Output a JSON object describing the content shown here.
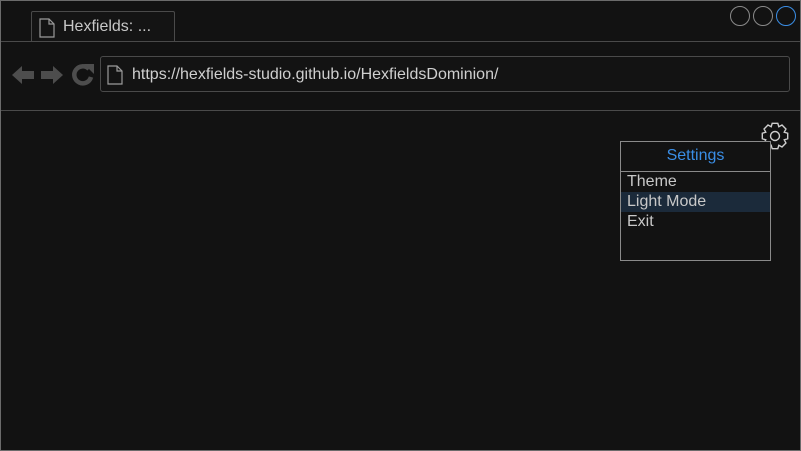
{
  "tab": {
    "title": "Hexfields: ..."
  },
  "window_controls": [
    "minimize",
    "maximize",
    "close"
  ],
  "toolbar": {
    "back_icon": "arrow-left-icon",
    "forward_icon": "arrow-right-icon",
    "reload_icon": "reload-icon"
  },
  "address": {
    "url": "https://hexfields-studio.github.io/HexfieldsDominion/"
  },
  "settings_menu": {
    "icon": "gear-icon",
    "title": "Settings",
    "items": [
      {
        "label": "Theme"
      },
      {
        "label": "Light Mode"
      },
      {
        "label": "Exit"
      }
    ],
    "highlighted_index": 1
  },
  "colors": {
    "background": "#121212",
    "accent": "#3a8ee6",
    "border": "#8a8a8a",
    "highlight": "#1b2a3a"
  }
}
